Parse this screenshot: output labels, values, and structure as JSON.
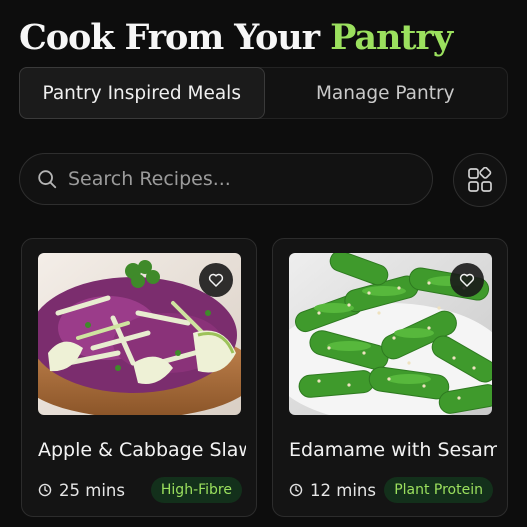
{
  "header": {
    "title_main": "Cook From Your ",
    "title_accent": "Pantry"
  },
  "tabs": [
    {
      "label": "Pantry Inspired Meals",
      "active": true
    },
    {
      "label": "Manage Pantry",
      "active": false
    }
  ],
  "search": {
    "placeholder": "Search Recipes...",
    "value": ""
  },
  "view_toggle": {
    "icon": "grid-icon"
  },
  "recipes": [
    {
      "name": "Apple & Cabbage Slaw",
      "time": "25 mins",
      "tag": "High-Fibre",
      "image": "apple-cabbage-slaw-photo",
      "favorite_icon": "heart-icon"
    },
    {
      "name": "Edamame with Sesam..",
      "time": "12 mins",
      "tag": "Plant Protein",
      "image": "edamame-photo",
      "favorite_icon": "heart-icon"
    }
  ],
  "colors": {
    "background": "#0d0d0d",
    "accent": "#9be05e",
    "tag_background": "#13301b",
    "card_border": "#2c2c2c"
  }
}
